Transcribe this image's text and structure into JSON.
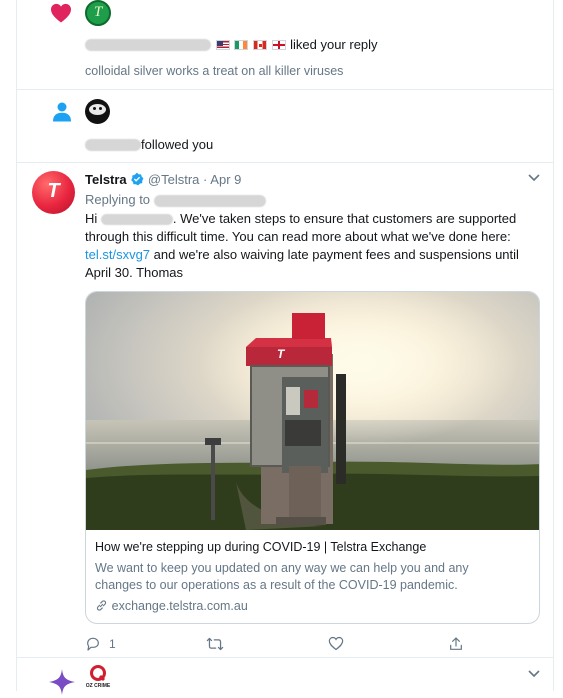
{
  "notifications": [
    {
      "type": "like",
      "action_text": "liked your reply",
      "reply_text": "colloidal silver works a treat on all killer viruses"
    },
    {
      "type": "follow",
      "action_text": "followed you"
    }
  ],
  "tweet": {
    "author_name": "Telstra",
    "handle": "@Telstra",
    "date_sep": "·",
    "date": "Apr 9",
    "replying_label": "Replying to",
    "body_prefix": "Hi",
    "body_part1": ". We've taken steps to ensure that customers are supported through this difficult time. You can read more about what we've done here:",
    "link_text": "tel.st/sxvg7",
    "body_part2": "and we're also waiving late payment fees and suspensions until April 30. Thomas",
    "card": {
      "title": "How we're stepping up during COVID-19 | Telstra Exchange",
      "description": "We want to keep you updated on any way we can help you and any changes to our operations as a result of the COVID-19 pandemic.",
      "domain": "exchange.telstra.com.au"
    },
    "reply_count": "1",
    "logo_letter": "T"
  },
  "bottom": {
    "avatar_label": "OZ CRIME"
  },
  "colors": {
    "like": "#e0245e",
    "follow": "#1da1f2",
    "link": "#1b95e0",
    "telstra": "#e8253f",
    "verified": "#1da1f2"
  }
}
